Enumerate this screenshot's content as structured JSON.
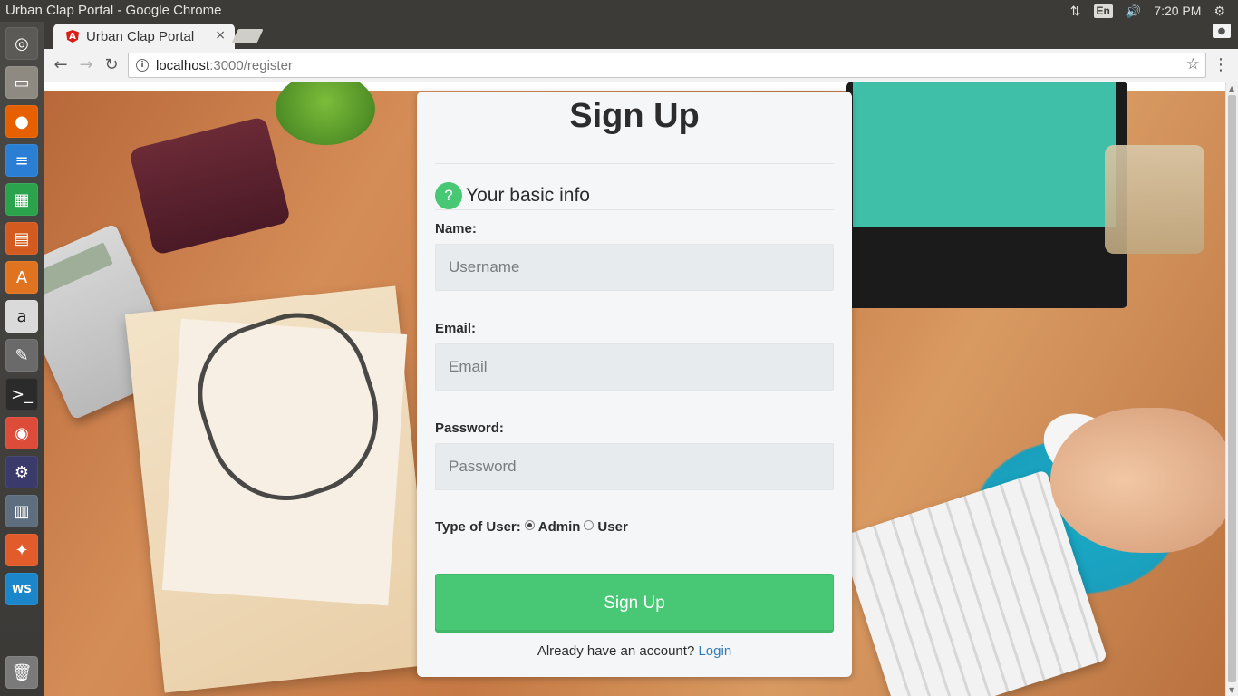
{
  "os": {
    "window_title": "Urban Clap Portal - Google Chrome",
    "keyboard_layout": "En",
    "clock": "7:20 PM"
  },
  "browser": {
    "tab_title": "Urban Clap Portal",
    "tab_close": "×",
    "url_host": "localhost",
    "url_path": ":3000/register"
  },
  "form": {
    "heading": "Sign Up",
    "section_icon": "?",
    "section_title": "Your basic info",
    "name_label": "Name:",
    "name_placeholder": "Username",
    "email_label": "Email:",
    "email_placeholder": "Email",
    "password_label": "Password:",
    "password_placeholder": "Password",
    "user_type_label": "Type of User:",
    "user_type_options": [
      "Admin",
      "User"
    ],
    "user_type_selected": "Admin",
    "submit_label": "Sign Up",
    "login_prompt": "Already have an account?",
    "login_link": "Login"
  },
  "colors": {
    "accent_green": "#48c774",
    "link_blue": "#2f7ab8",
    "card_bg": "#f4f6f7"
  },
  "launcher_icons": [
    "ubuntu-dash-icon",
    "files-icon",
    "firefox-icon",
    "writer-icon",
    "calc-icon",
    "impress-icon",
    "software-center-icon",
    "amazon-icon",
    "settings-icon",
    "terminal-icon",
    "chrome-icon",
    "eclipse-icon",
    "system-monitor-icon",
    "ws-icon",
    "trash-icon"
  ]
}
